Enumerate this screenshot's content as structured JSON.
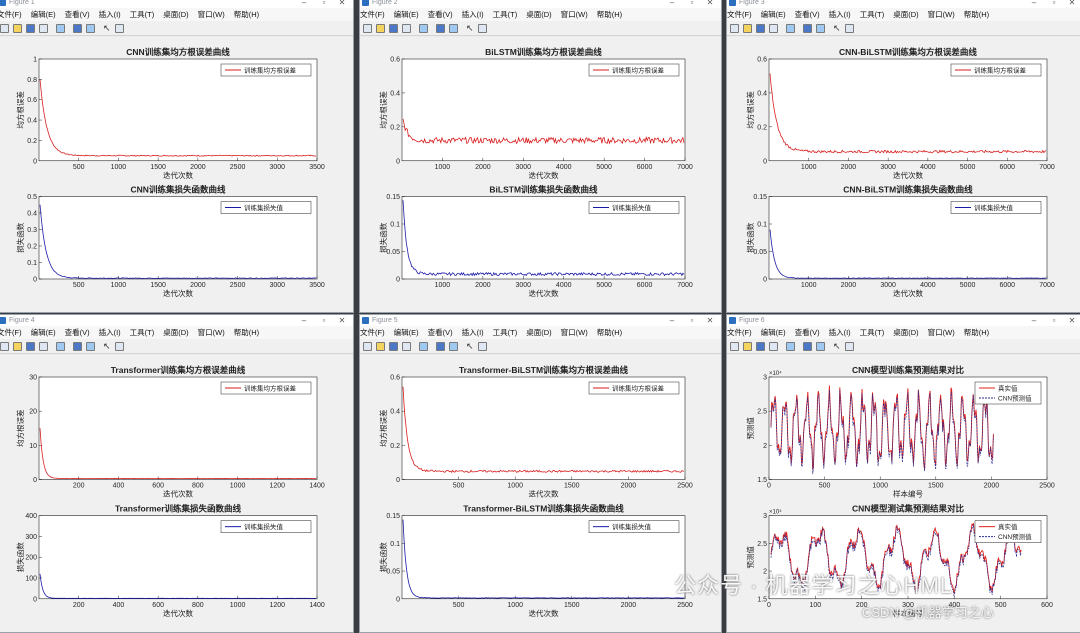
{
  "menu": [
    "文件(F)",
    "编辑(E)",
    "查看(V)",
    "插入(I)",
    "工具(T)",
    "桌面(D)",
    "窗口(W)",
    "帮助(H)"
  ],
  "windows": [
    {
      "title": "Figure 1",
      "upper": {
        "title": "CNN训练集均方根误差曲线",
        "ylabel": "均方根误差",
        "xlabel": "迭代次数",
        "legend": "训练集均方根误差",
        "yticks": [
          "0",
          "0.2",
          "0.4",
          "0.6",
          "0.8",
          "1"
        ],
        "xticks": [
          "500",
          "1000",
          "1500",
          "2000",
          "2500",
          "3000",
          "3500"
        ]
      },
      "lower": {
        "title": "CNN训练集损失函数曲线",
        "ylabel": "损失函数",
        "xlabel": "迭代次数",
        "legend": "训练集损失值",
        "yticks": [
          "0",
          "0.1",
          "0.2",
          "0.3",
          "0.4",
          "0.5"
        ],
        "xticks": [
          "500",
          "1000",
          "1500",
          "2000",
          "2500",
          "3000",
          "3500"
        ]
      }
    },
    {
      "title": "Figure 2",
      "upper": {
        "title": "BiLSTM训练集均方根误差曲线",
        "ylabel": "均方根误差",
        "xlabel": "迭代次数",
        "legend": "训练集均方根误差",
        "yticks": [
          "0",
          "0.2",
          "0.4",
          "0.6"
        ],
        "xticks": [
          "1000",
          "2000",
          "3000",
          "4000",
          "5000",
          "6000",
          "7000"
        ]
      },
      "lower": {
        "title": "BiLSTM训练集损失函数曲线",
        "ylabel": "损失函数",
        "xlabel": "迭代次数",
        "legend": "训练集损失值",
        "yticks": [
          "0",
          "0.05",
          "0.1",
          "0.15"
        ],
        "xticks": [
          "1000",
          "2000",
          "3000",
          "4000",
          "5000",
          "6000",
          "7000"
        ]
      }
    },
    {
      "title": "Figure 3",
      "upper": {
        "title": "CNN-BiLSTM训练集均方根误差曲线",
        "ylabel": "均方根误差",
        "xlabel": "迭代次数",
        "legend": "训练集均方根误差",
        "yticks": [
          "0",
          "0.2",
          "0.4",
          "0.6"
        ],
        "xticks": [
          "1000",
          "2000",
          "3000",
          "4000",
          "5000",
          "6000",
          "7000"
        ]
      },
      "lower": {
        "title": "CNN-BiLSTM训练集损失函数曲线",
        "ylabel": "损失函数",
        "xlabel": "迭代次数",
        "legend": "训练集损失值",
        "yticks": [
          "0",
          "0.05",
          "0.1",
          "0.15"
        ],
        "xticks": [
          "1000",
          "2000",
          "3000",
          "4000",
          "5000",
          "6000",
          "7000"
        ]
      }
    },
    {
      "title": "Figure 4",
      "upper": {
        "title": "Transformer训练集均方根误差曲线",
        "ylabel": "均方根误差",
        "xlabel": "迭代次数",
        "legend": "训练集均方根误差",
        "yticks": [
          "0",
          "10",
          "20",
          "30"
        ],
        "xticks": [
          "200",
          "400",
          "600",
          "800",
          "1000",
          "1200",
          "1400"
        ]
      },
      "lower": {
        "title": "Transformer训练集损失函数曲线",
        "ylabel": "损失函数",
        "xlabel": "迭代次数",
        "legend": "训练集损失值",
        "yticks": [
          "0",
          "100",
          "200",
          "300",
          "400"
        ],
        "xticks": [
          "200",
          "400",
          "600",
          "800",
          "1000",
          "1200",
          "1400"
        ]
      }
    },
    {
      "title": "Figure 5",
      "upper": {
        "title": "Transformer-BiLSTM训练集均方根误差曲线",
        "ylabel": "均方根误差",
        "xlabel": "迭代次数",
        "legend": "训练集均方根误差",
        "yticks": [
          "0",
          "0.2",
          "0.4",
          "0.6"
        ],
        "xticks": [
          "500",
          "1000",
          "1500",
          "2000",
          "2500"
        ]
      },
      "lower": {
        "title": "Transformer-BiLSTM训练集损失函数曲线",
        "ylabel": "损失函数",
        "xlabel": "迭代次数",
        "legend": "训练集损失值",
        "yticks": [
          "0",
          "0.05",
          "0.1",
          "0.15"
        ],
        "xticks": [
          "500",
          "1000",
          "1500",
          "2000",
          "2500"
        ]
      }
    },
    {
      "title": "Figure 6",
      "upper": {
        "title": "CNN模型训练集预测结果对比",
        "ylabel": "预测值",
        "xlabel": "样本编号",
        "legend": "真实值",
        "legend2": "CNN预测值",
        "yticks": [
          "1.5",
          "2",
          "2.5",
          "3"
        ],
        "xticks": [
          "0",
          "500",
          "1000",
          "1500",
          "2000",
          "2500"
        ],
        "exponent": "×10⁴"
      },
      "lower": {
        "title": "CNN模型测试集预测结果对比",
        "ylabel": "预测值",
        "xlabel": "样本编号",
        "legend": "真实值",
        "legend2": "CNN预测值",
        "yticks": [
          "1.5",
          "2",
          "2.5",
          "3"
        ],
        "xticks": [
          "0",
          "100",
          "200",
          "300",
          "400",
          "500",
          "600"
        ],
        "exponent": "×10⁴"
      }
    }
  ],
  "watermark": {
    "main": "公众号 · 机器学习之心HML",
    "sub": "CSDN @机器学习之心"
  }
}
